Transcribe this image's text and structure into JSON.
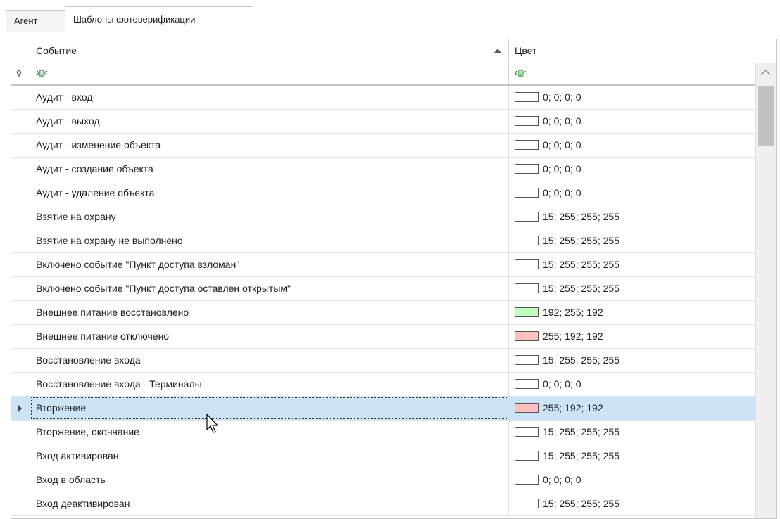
{
  "tabs": [
    {
      "label": "Агент",
      "active": false
    },
    {
      "label": "Шаблоны фотоверификации",
      "active": true
    }
  ],
  "grid": {
    "columns": [
      {
        "label": "Событие",
        "sort": "ascending"
      },
      {
        "label": "Цвет"
      }
    ],
    "filter_icon": "abc-text-filter-icon",
    "pin_icon": "pin-icon",
    "rows": [
      {
        "event": "Аудит - вход",
        "color": "0; 0; 0; 0",
        "swatch": "#ffffff"
      },
      {
        "event": "Аудит - выход",
        "color": "0; 0; 0; 0",
        "swatch": "#ffffff"
      },
      {
        "event": "Аудит - изменение объекта",
        "color": "0; 0; 0; 0",
        "swatch": "#ffffff"
      },
      {
        "event": "Аудит - создание объекта",
        "color": "0; 0; 0; 0",
        "swatch": "#ffffff"
      },
      {
        "event": "Аудит - удаление объекта",
        "color": "0; 0; 0; 0",
        "swatch": "#ffffff"
      },
      {
        "event": "Взятие на охрану",
        "color": "15; 255; 255; 255",
        "swatch": "#ffffff"
      },
      {
        "event": "Взятие на охрану не выполнено",
        "color": "15; 255; 255; 255",
        "swatch": "#ffffff"
      },
      {
        "event": "Включено событие \"Пункт доступа взломан\"",
        "color": "15; 255; 255; 255",
        "swatch": "#ffffff"
      },
      {
        "event": "Включено событие \"Пункт доступа оставлен открытым\"",
        "color": "15; 255; 255; 255",
        "swatch": "#ffffff"
      },
      {
        "event": "Внешнее питание восстановлено",
        "color": "192; 255; 192",
        "swatch": "#c0ffc0"
      },
      {
        "event": "Внешнее питание отключено",
        "color": "255; 192; 192",
        "swatch": "#ffc0c0"
      },
      {
        "event": "Восстановление входа",
        "color": "15; 255; 255; 255",
        "swatch": "#ffffff"
      },
      {
        "event": "Восстановление входа - Терминалы",
        "color": "0; 0; 0; 0",
        "swatch": "#ffffff"
      },
      {
        "event": "Вторжение",
        "color": "255; 192; 192",
        "swatch": "#ffc0c0",
        "selected": true
      },
      {
        "event": "Вторжение, окончание",
        "color": "15; 255; 255; 255",
        "swatch": "#ffffff"
      },
      {
        "event": "Вход активирован",
        "color": "15; 255; 255; 255",
        "swatch": "#ffffff"
      },
      {
        "event": "Вход в область",
        "color": "0; 0; 0; 0",
        "swatch": "#ffffff"
      },
      {
        "event": "Вход деактивирован",
        "color": "15; 255; 255; 255",
        "swatch": "#ffffff"
      }
    ]
  },
  "colors": {
    "selected_row": "#cde4f7",
    "border": "#c6c6c6"
  }
}
